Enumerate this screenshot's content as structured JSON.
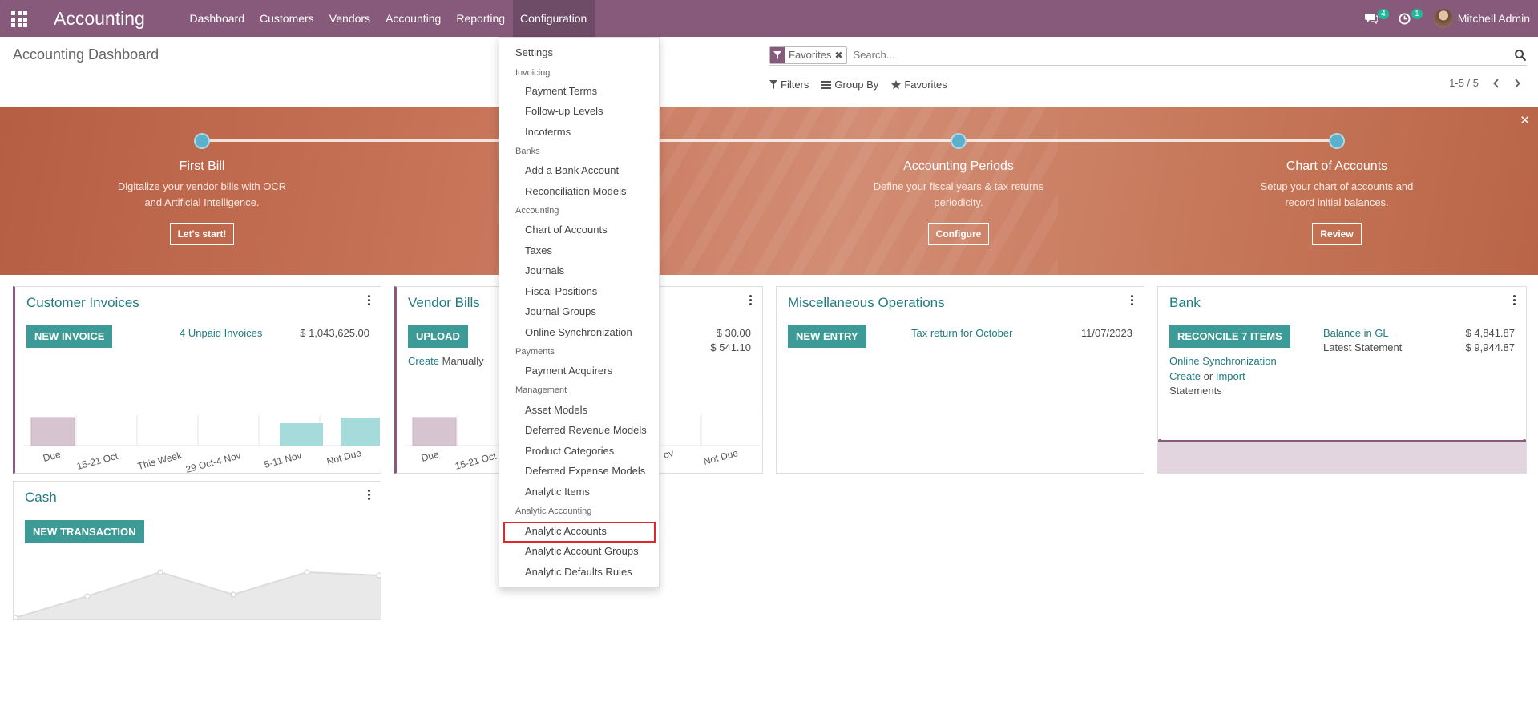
{
  "topbar": {
    "app_title": "Accounting",
    "menu": [
      "Dashboard",
      "Customers",
      "Vendors",
      "Accounting",
      "Reporting",
      "Configuration"
    ],
    "chat_count": "4",
    "activity_count": "1",
    "user_name": "Mitchell Admin",
    "icons": [
      "apps-icon",
      "chat-icon",
      "clock-icon",
      "avatar"
    ]
  },
  "control_panel": {
    "title": "Accounting Dashboard",
    "facet": "Favorites",
    "search_placeholder": "Search...",
    "filters": "Filters",
    "group_by": "Group By",
    "favorites": "Favorites",
    "pager": "1-5 / 5"
  },
  "onboarding": {
    "steps": [
      {
        "title": "First Bill",
        "desc": "Digitalize your vendor bills with OCR and Artificial Intelligence.",
        "button": "Let's start!"
      },
      {
        "title": "Accounting Periods",
        "desc": "Define your fiscal years & tax returns periodicity.",
        "button": "Configure"
      },
      {
        "title": "Chart of Accounts",
        "desc": "Setup your chart of accounts and record initial balances.",
        "button": "Review"
      }
    ]
  },
  "cards": {
    "customer_invoices": {
      "title": "Customer Invoices",
      "button": "NEW INVOICE",
      "unpaid": "4 Unpaid Invoices",
      "amount": "$ 1,043,625.00",
      "bar_labels": [
        "Due",
        "15-21 Oct",
        "This Week",
        "29 Oct-4 Nov",
        "5-11 Nov",
        "Not Due"
      ]
    },
    "vendor_bills": {
      "title": "Vendor Bills",
      "button": "UPLOAD",
      "create": "Create",
      "manually": "Manually",
      "amount1": "$ 30.00",
      "amount2": "$ 541.10",
      "bar_labels": [
        "Due",
        "15-21 Oct",
        "ov",
        "Not Due"
      ]
    },
    "misc": {
      "title": "Miscellaneous Operations",
      "button": "NEW ENTRY",
      "tax_link": "Tax return for October",
      "date": "11/07/2023"
    },
    "bank": {
      "title": "Bank",
      "button": "RECONCILE 7 ITEMS",
      "online_sync": "Online Synchronization",
      "create": "Create",
      "or": "or",
      "import": "Import",
      "statements": "Statements",
      "balance_gl": "Balance in GL",
      "balance_gl_amount": "$ 4,841.87",
      "latest_statement": "Latest Statement",
      "latest_amount": "$ 9,944.87"
    },
    "cash": {
      "title": "Cash",
      "button": "NEW TRANSACTION"
    }
  },
  "config_menu": {
    "settings": "Settings",
    "sections": [
      {
        "header": "Invoicing",
        "items": [
          "Payment Terms",
          "Follow-up Levels",
          "Incoterms"
        ]
      },
      {
        "header": "Banks",
        "items": [
          "Add a Bank Account",
          "Reconciliation Models"
        ]
      },
      {
        "header": "Accounting",
        "items": [
          "Chart of Accounts",
          "Taxes",
          "Journals",
          "Fiscal Positions",
          "Journal Groups",
          "Online Synchronization"
        ]
      },
      {
        "header": "Payments",
        "items": [
          "Payment Acquirers"
        ]
      },
      {
        "header": "Management",
        "items": [
          "Asset Models",
          "Deferred Revenue Models",
          "Product Categories",
          "Deferred Expense Models",
          "Analytic Items"
        ]
      },
      {
        "header": "Analytic Accounting",
        "items": [
          "Analytic Accounts",
          "Analytic Account Groups",
          "Analytic Defaults Rules"
        ]
      }
    ]
  }
}
